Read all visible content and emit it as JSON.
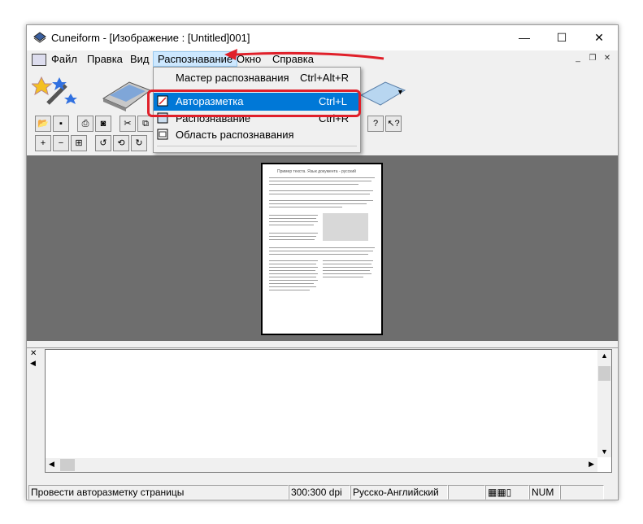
{
  "window": {
    "title": "Cuneiform - [Изображение : [Untitled]001]",
    "controls": {
      "minimize": "—",
      "maximize": "☐",
      "close": "✕"
    }
  },
  "menu": {
    "items": [
      "Файл",
      "Правка",
      "Вид",
      "Распознавание",
      "Окно",
      "Справка"
    ],
    "mdi": {
      "minimize": "_",
      "restore": "❐",
      "close": "✕"
    }
  },
  "dropdown": {
    "items": [
      {
        "label": "Мастер распознавания",
        "shortcut": "Ctrl+Alt+R"
      },
      {
        "label": "Авторазметка",
        "shortcut": "Ctrl+L"
      },
      {
        "label": "Распознавание",
        "shortcut": "Ctrl+R"
      },
      {
        "label": "Область распознавания",
        "shortcut": ""
      }
    ]
  },
  "statusbar": {
    "message": "Провести авторазметку страницы",
    "dpi": "300:300 dpi",
    "language": "Русско-Английский",
    "num": "NUM"
  },
  "document": {
    "heading": "Пример текста. Язык документа - русский"
  },
  "colors": {
    "highlight": "#0078d7",
    "annotation": "#e0202a",
    "workspace": "#6e6e6e"
  }
}
